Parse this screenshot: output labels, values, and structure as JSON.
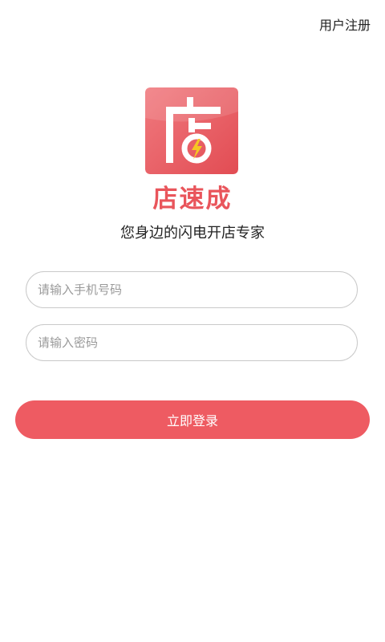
{
  "header": {
    "register_label": "用户注册"
  },
  "logo": {
    "glyph": "店",
    "icon": "lightning-bolt-icon",
    "bg_color": "#e9555b",
    "bolt_color": "#f6c623"
  },
  "brand": {
    "name": "店速成",
    "color": "#e9555b"
  },
  "slogan": "您身边的闪电开店专家",
  "form": {
    "phone_placeholder": "请输入手机号码",
    "phone_value": "",
    "password_placeholder": "请输入密码",
    "password_value": "",
    "login_label": "立即登录",
    "login_color": "#ee5b62"
  }
}
